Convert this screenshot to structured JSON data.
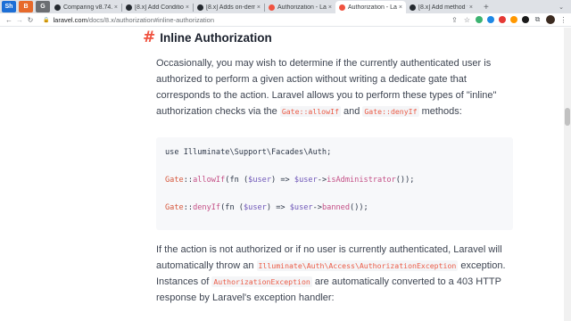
{
  "browser": {
    "pinned_tabs": [
      {
        "label": "Sh",
        "color": "#1d6fd6"
      },
      {
        "label": "B",
        "color": "#e76a2b"
      },
      {
        "label": "G",
        "color": "#6c6f73"
      }
    ],
    "tabs": [
      {
        "title": "Comparing v8.74.0...",
        "favicon_color": "#24292f"
      },
      {
        "title": "[8.x] Add Condition...",
        "favicon_color": "#24292f"
      },
      {
        "title": "[8.x] Adds on-dem...",
        "favicon_color": "#24292f"
      },
      {
        "title": "Authorization - Lar...",
        "favicon_color": "#f05340"
      },
      {
        "title": "Authorization - La...",
        "favicon_color": "#f05340",
        "active": true
      },
      {
        "title": "[8.x] Add method t...",
        "favicon_color": "#24292f"
      }
    ],
    "url_host": "laravel.com",
    "url_path": "/docs/8.x/authorization#inline-authorization",
    "icons": {
      "back": "←",
      "forward": "→",
      "reload": "↻",
      "lock": "🔒",
      "share": "⇪",
      "star": "☆",
      "puzzle": "⧉",
      "menu": "⋮",
      "newtab": "+",
      "tab_close": "×",
      "tabs_dropdown": "⌄"
    },
    "extension_colors": [
      "#3cb371",
      "#1e88e5",
      "#e53935",
      "#ff9800",
      "#1a1a1a"
    ]
  },
  "doc": {
    "hash": "#",
    "title": "Inline Authorization",
    "para1": {
      "text_a": "Occasionally, you may wish to determine if the currently authenticated user is authorized to perform a given action without writing a dedicate gate that corresponds to the action. Laravel allows you to perform these types of \"inline\" authorization checks via the ",
      "code_a": "Gate::allowIf",
      "text_b": " and ",
      "code_b": "Gate::denyIf",
      "text_c": " methods:"
    },
    "code": {
      "line1": {
        "kw": "use ",
        "rest": "Illuminate\\Support\\Facades\\Auth;"
      },
      "line2": {
        "cls": "Gate",
        "sep": "::",
        "fn": "allowIf",
        "open": "(fn (",
        "var": "$user",
        "arrow": ") => ",
        "var2": "$user",
        "arr2": "->",
        "method": "isAdministrator",
        "close": "());"
      },
      "line3": {
        "cls": "Gate",
        "sep": "::",
        "fn": "denyIf",
        "open": "(fn (",
        "var": "$user",
        "arrow": ") => ",
        "var2": "$user",
        "arr2": "->",
        "method": "banned",
        "close": "());"
      }
    },
    "para2": {
      "text_a": "If the action is not authorized or if no user is currently authenticated, Laravel will automatically throw an ",
      "code_a": "Illuminate\\Auth\\Access\\AuthorizationException",
      "text_b": " exception. Instances of ",
      "code_b": "AuthorizationException",
      "text_c": " are automatically converted to a 403 HTTP response by Laravel's exception handler:"
    }
  }
}
